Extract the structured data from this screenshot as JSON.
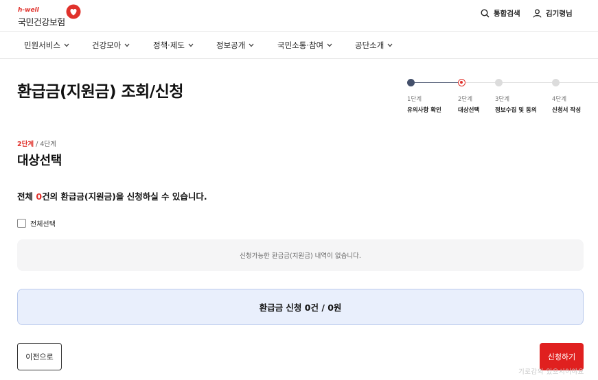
{
  "brand": {
    "sub": "h-well",
    "name": "국민건강보험",
    "accent_color": "#e0312b"
  },
  "utility": {
    "search_label": "통합검색",
    "user_label": "김기령님"
  },
  "nav": [
    {
      "label": "민원서비스"
    },
    {
      "label": "건강모아"
    },
    {
      "label": "정책·제도"
    },
    {
      "label": "정보공개"
    },
    {
      "label": "국민소통·참여"
    },
    {
      "label": "공단소개"
    }
  ],
  "page_title": "환급금(지원금) 조회/신청",
  "stepper": [
    {
      "num": "1단계",
      "name": "유의사항 확인",
      "state": "done"
    },
    {
      "num": "2단계",
      "name": "대상선택",
      "state": "current"
    },
    {
      "num": "3단계",
      "name": "정보수집 및 동의",
      "state": "todo"
    },
    {
      "num": "4단계",
      "name": "신청서 작성",
      "state": "todo"
    }
  ],
  "step_indicator": {
    "current": "2단계",
    "total": " / 4단계"
  },
  "section_title": "대상선택",
  "summary": {
    "prefix": "전체 ",
    "count": "0",
    "suffix": "건의 환급금(지원금)을 신청하실 수 있습니다."
  },
  "select_all_label": "전체선택",
  "empty_message": "신청가능한 환급금(지원금) 내역이 없습니다.",
  "total_text": "환급금 신청 0건 / 0원",
  "buttons": {
    "prev": "이전으로",
    "apply": "신청하기"
  },
  "watermark": "기로감의 있으시어야요"
}
